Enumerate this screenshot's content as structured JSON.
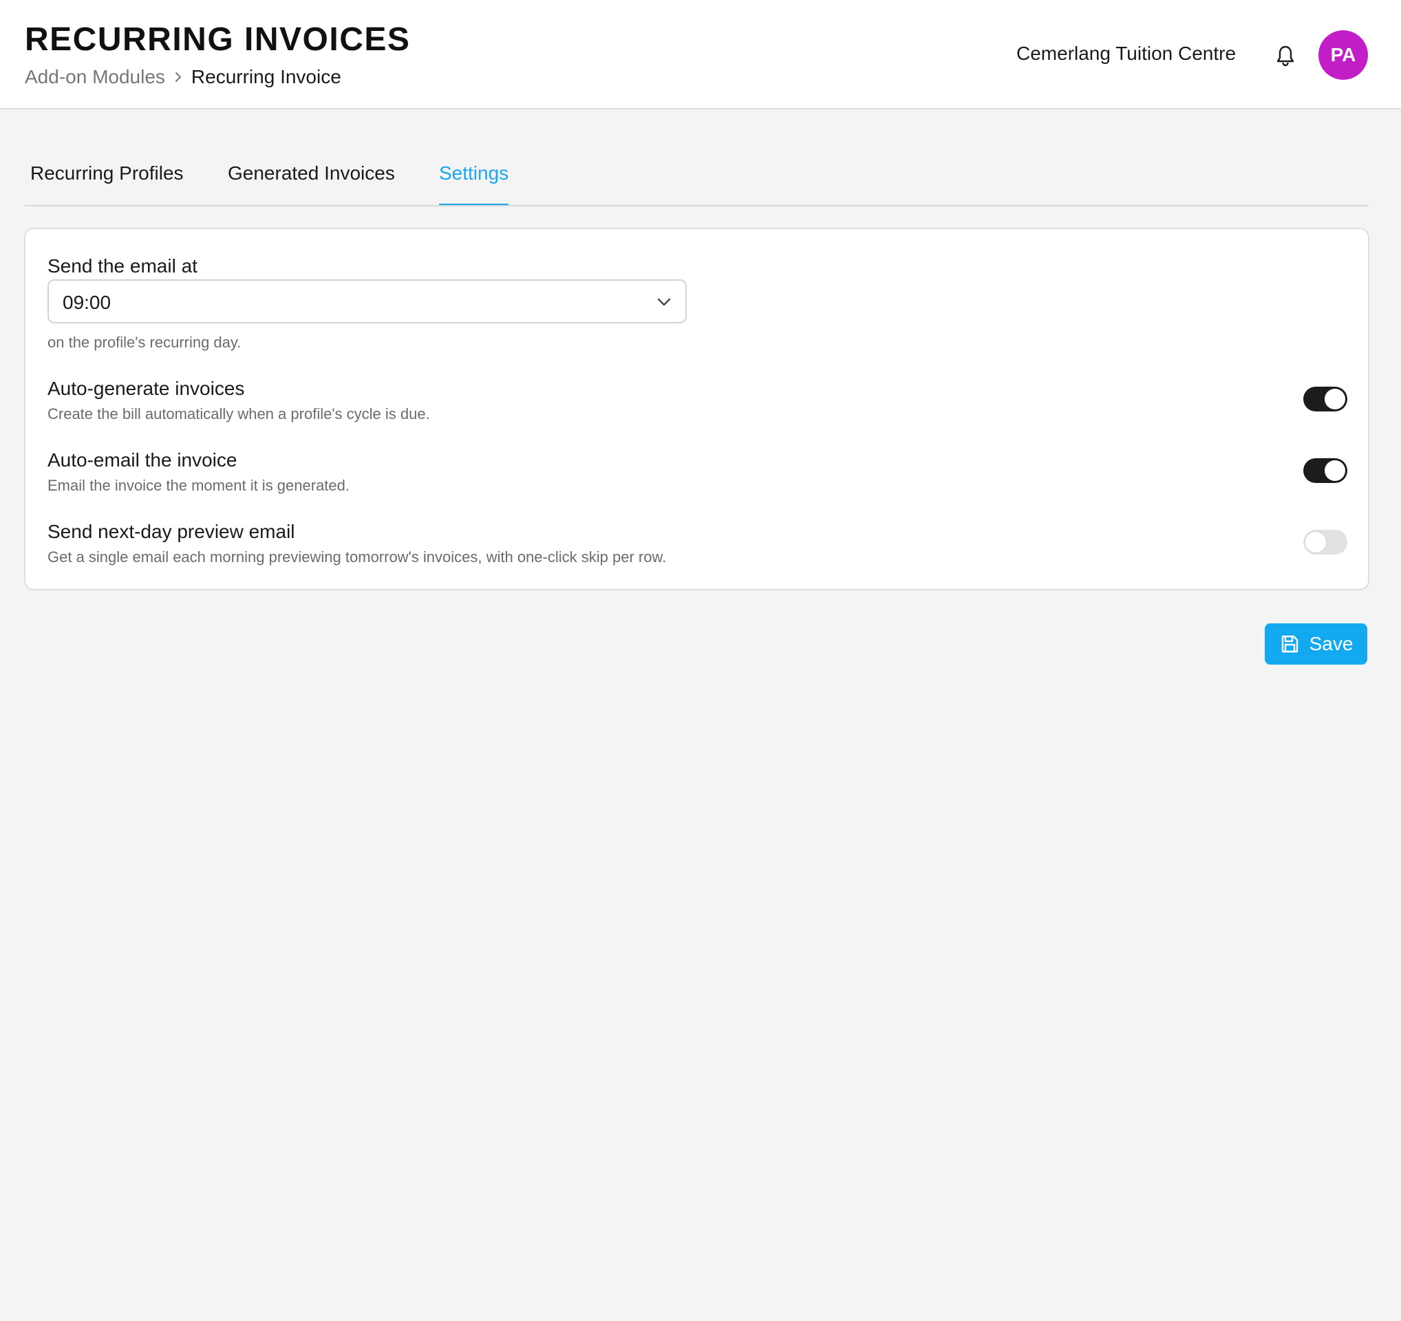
{
  "header": {
    "title": "RECURRING INVOICES",
    "breadcrumb": {
      "parent": "Add-on Modules",
      "current": "Recurring Invoice"
    },
    "org_name": "Cemerlang Tuition Centre",
    "avatar_initials": "PA",
    "avatar_color": "#c11ec8"
  },
  "tabs": [
    {
      "label": "Recurring Profiles",
      "active": false
    },
    {
      "label": "Generated Invoices",
      "active": false
    },
    {
      "label": "Settings",
      "active": true
    }
  ],
  "accent_color": "#1aa6ee",
  "settings": {
    "send_time": {
      "label": "Send the email at",
      "value": "09:00",
      "help": "on the profile's recurring day."
    },
    "toggles": [
      {
        "title": "Auto-generate invoices",
        "description": "Create the bill automatically when a profile's cycle is due.",
        "enabled": true
      },
      {
        "title": "Auto-email the invoice",
        "description": "Email the invoice the moment it is generated.",
        "enabled": true
      },
      {
        "title": "Send next-day preview email",
        "description": "Get a single email each morning previewing tomorrow's invoices, with one-click skip per row.",
        "enabled": false
      }
    ]
  },
  "actions": {
    "save_label": "Save",
    "save_icon": "floppy-disk-icon"
  }
}
